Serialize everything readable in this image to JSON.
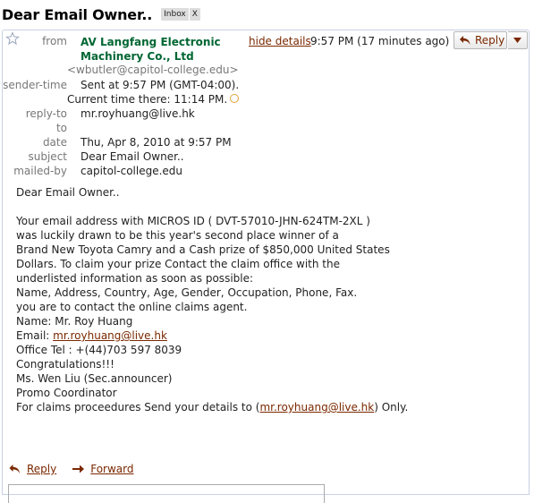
{
  "subject": {
    "title": "Dear Email Owner..",
    "label": "Inbox",
    "label_remove": "X"
  },
  "header": {
    "from_label": "from",
    "from_name_line1": "AV Langfang Electronic",
    "from_name_line2": "Machinery Co., Ltd",
    "from_email": "<wbutler@capitol-college.edu>",
    "hide_details": "hide details",
    "time": "9:57 PM (17 minutes ago)",
    "reply_button": "Reply",
    "sender_time_label": "sender-time",
    "sender_time_value": "Sent at 9:57 PM (GMT-04:00).",
    "current_time_value": "Current time there: 11:14 PM.",
    "reply_to_label": "reply-to",
    "reply_to_value": "mr.royhuang@live.hk",
    "to_label": "to",
    "to_value": "",
    "date_label": "date",
    "date_value": "Thu, Apr 8, 2010 at 9:57 PM",
    "subject_label": "subject",
    "subject_value": "Dear Email Owner..",
    "mailed_by_label": "mailed-by",
    "mailed_by_value": "capitol-college.edu"
  },
  "body": {
    "greeting": "Dear Email Owner..",
    "lines": [
      "Your email address with MICROS ID ( DVT-57010-JHN-624TM-2XL )",
      "was luckily drawn to be this year's second place winner of a",
      "Brand New Toyota Camry and a Cash prize of $850,000 United States",
      "Dollars. To claim your prize Contact the claim office with the",
      "underlisted information as soon as possible:",
      "Name, Address, Country, Age, Gender, Occupation, Phone, Fax.",
      "you are to contact the online claims agent.",
      "Name: Mr. Roy Huang"
    ],
    "email_label": "Email: ",
    "email_link": "mr.royhuang@live.hk",
    "lines2": [
      "Office Tel : +(44)703 597 8039",
      "Congratulations!!!",
      "Ms. Wen Liu (Sec.announcer)",
      "Promo Coordinator"
    ],
    "closing_prefix": "For claims proceedures Send your details to (",
    "closing_link": "mr.royhuang@live.hk",
    "closing_suffix": ") Only."
  },
  "footer": {
    "reply": "Reply",
    "forward": "Forward"
  },
  "colors": {
    "sender_green": "#006633",
    "link_brown": "#7a2800",
    "label_grey": "#777777",
    "border_blue": "#c6d1e3"
  },
  "icons": [
    "star-icon",
    "reply-arrow-icon",
    "dropdown-arrow-icon",
    "clock-icon",
    "forward-arrow-icon"
  ]
}
